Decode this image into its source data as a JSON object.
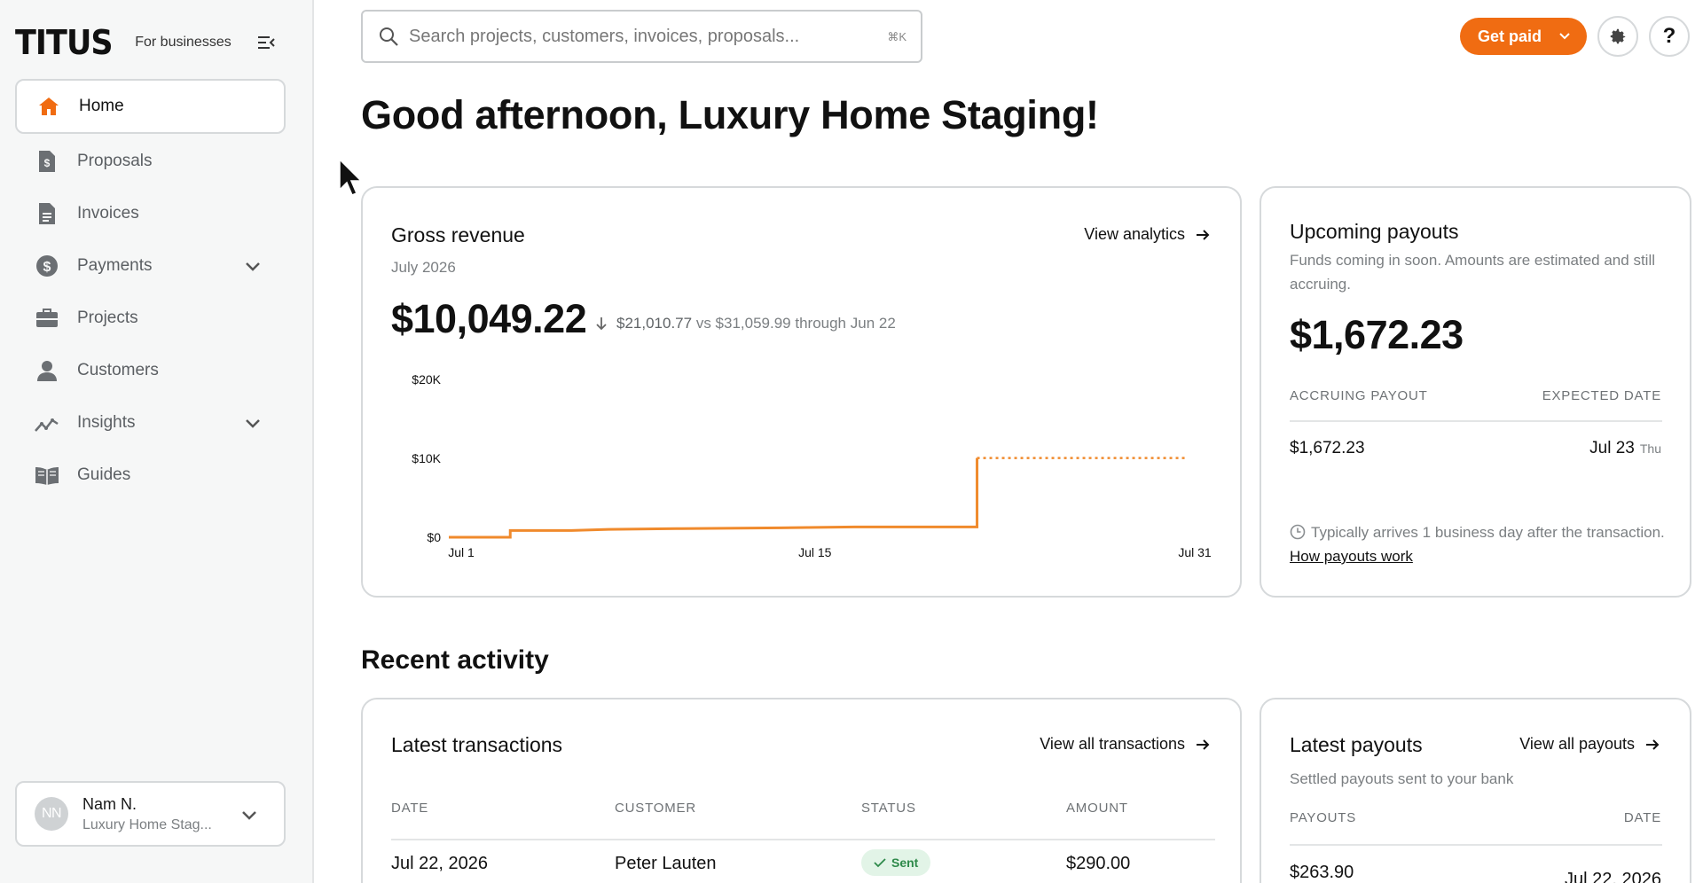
{
  "brand": {
    "logo": "TITUS",
    "subtitle": "For businesses"
  },
  "sidebar": {
    "items": [
      {
        "label": "Home",
        "icon": "home-icon",
        "active": true
      },
      {
        "label": "Proposals",
        "icon": "proposal-icon"
      },
      {
        "label": "Invoices",
        "icon": "invoice-icon"
      },
      {
        "label": "Payments",
        "icon": "dollar-icon",
        "expandable": true
      },
      {
        "label": "Projects",
        "icon": "briefcase-icon"
      },
      {
        "label": "Customers",
        "icon": "person-icon"
      },
      {
        "label": "Insights",
        "icon": "trend-icon",
        "expandable": true
      },
      {
        "label": "Guides",
        "icon": "book-icon"
      }
    ],
    "account": {
      "initials": "NN",
      "name": "Nam N.",
      "business": "Luxury Home Stag..."
    }
  },
  "search": {
    "placeholder": "Search projects, customers, invoices, proposals...",
    "shortcut": "⌘K"
  },
  "header": {
    "get_paid": "Get paid",
    "help": "?"
  },
  "greeting": "Good afternoon, Luxury Home Staging!",
  "revenue": {
    "title": "Gross revenue",
    "link": "View analytics",
    "period": "July 2026",
    "amount": "$10,049.22",
    "change": "$21,010.77",
    "compare": "vs $31,059.99 through Jun 22"
  },
  "chart_data": {
    "type": "line",
    "step": true,
    "x_ticks": [
      "Jul 1",
      "Jul 15",
      "Jul 31"
    ],
    "y_ticks": [
      "$0",
      "$10K",
      "$20K"
    ],
    "ylim": [
      0,
      20000
    ],
    "xlim": [
      1,
      31
    ],
    "series": [
      {
        "style": "solid",
        "points": [
          [
            1,
            0
          ],
          [
            3.5,
            0
          ],
          [
            3.5,
            850
          ],
          [
            6,
            850
          ],
          [
            7.5,
            1000
          ],
          [
            10.5,
            1100
          ],
          [
            14.5,
            1200
          ],
          [
            17.5,
            1300
          ],
          [
            22.5,
            1300
          ],
          [
            22.5,
            10049
          ]
        ]
      },
      {
        "style": "dotted",
        "points": [
          [
            22.5,
            10049
          ],
          [
            31,
            10049
          ]
        ]
      }
    ],
    "color": "#f08a2c"
  },
  "payouts": {
    "title": "Upcoming payouts",
    "desc": "Funds coming in soon. Amounts are estimated and still accruing.",
    "amount": "$1,672.23",
    "col_accruing": "ACCRUING PAYOUT",
    "col_expected": "EXPECTED DATE",
    "row_amount": "$1,672.23",
    "row_date": "Jul 23",
    "row_dow": "Thu",
    "note": "Typically arrives 1 business day after the transaction.",
    "note_link": "How payouts work"
  },
  "recent_activity": "Recent activity",
  "transactions": {
    "title": "Latest transactions",
    "link": "View all transactions",
    "headers": [
      "DATE",
      "CUSTOMER",
      "STATUS",
      "AMOUNT"
    ],
    "rows": [
      {
        "date": "Jul 22, 2026",
        "customer": "Peter Lauten",
        "status": "Sent",
        "amount": "$290.00"
      }
    ]
  },
  "latest_payouts": {
    "title": "Latest payouts",
    "link": "View all payouts",
    "subtitle": "Settled payouts sent to your bank",
    "headers": [
      "PAYOUTS",
      "DATE"
    ],
    "rows": [
      {
        "amount": "$263.90",
        "date": "Jul 22, 2026"
      }
    ]
  },
  "colors": {
    "accent": "#f06c12",
    "success_bg": "#e2f4e7",
    "success_fg": "#2e8a4a"
  }
}
